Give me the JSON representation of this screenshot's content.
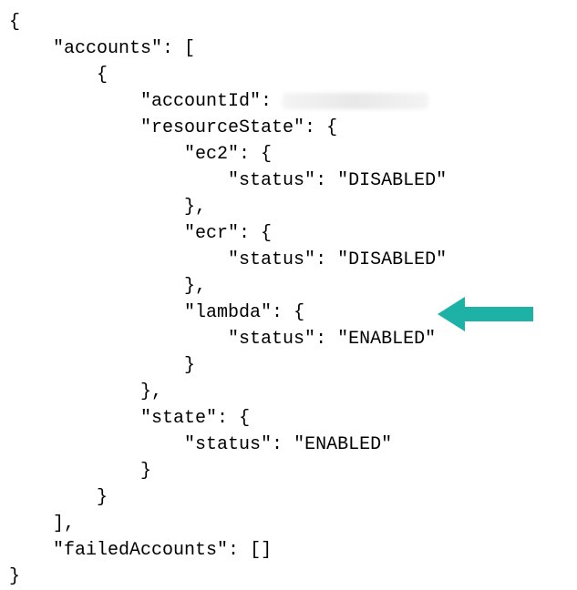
{
  "tokens": {
    "brace_open": "{",
    "brace_close": "}",
    "bracket_open": "[",
    "bracket_close": "]",
    "brace_close_comma": "},",
    "bracket_close_comma": "],",
    "empty_array": "[]"
  },
  "keys": {
    "accounts": "\"accounts\": ",
    "accountId": "\"accountId\": ",
    "resourceState": "\"resourceState\": ",
    "ec2": "\"ec2\": ",
    "ecr": "\"ecr\": ",
    "lambda": "\"lambda\": ",
    "status": "\"status\": ",
    "state": "\"state\": ",
    "failedAccounts": "\"failedAccounts\": "
  },
  "values": {
    "disabled": "\"DISABLED\"",
    "enabled": "\"ENABLED\""
  },
  "annotation": {
    "arrow_color": "#1eb2a6",
    "arrow_target": "lambda.status ENABLED"
  },
  "chart_data": {
    "type": "table",
    "title": "JSON response",
    "accounts": [
      {
        "accountId": "(redacted)",
        "resourceState": {
          "ec2": {
            "status": "DISABLED"
          },
          "ecr": {
            "status": "DISABLED"
          },
          "lambda": {
            "status": "ENABLED"
          }
        },
        "state": {
          "status": "ENABLED"
        }
      }
    ],
    "failedAccounts": []
  }
}
